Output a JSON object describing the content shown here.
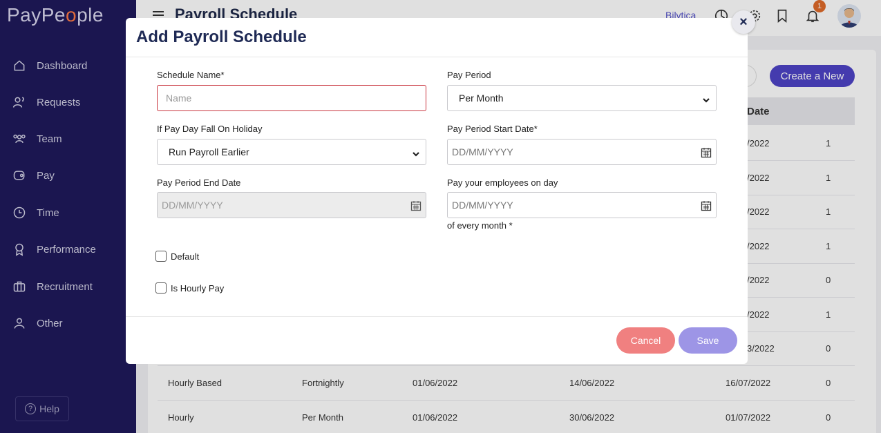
{
  "sidebar": {
    "logo": "PayPeople",
    "items": [
      {
        "label": "Dashboard",
        "icon": "home-icon"
      },
      {
        "label": "Requests",
        "icon": "request-icon"
      },
      {
        "label": "Team",
        "icon": "team-icon"
      },
      {
        "label": "Pay",
        "icon": "wallet-icon"
      },
      {
        "label": "Time",
        "icon": "clock-icon"
      },
      {
        "label": "Performance",
        "icon": "award-icon"
      },
      {
        "label": "Recruitment",
        "icon": "briefcase-icon"
      },
      {
        "label": "Other",
        "icon": "user-icon"
      }
    ],
    "help_label": "Help"
  },
  "header": {
    "title": "Payroll Schedule",
    "company": "Bilytica",
    "notification_count": "1"
  },
  "page": {
    "create_button": "Create a New",
    "date_header": "Date",
    "rows": [
      {
        "end": "/2022",
        "count": "1"
      },
      {
        "end": "/2022",
        "count": "1"
      },
      {
        "end": "/2022",
        "count": "1"
      },
      {
        "end": "/2022",
        "count": "1"
      },
      {
        "end": "/2022",
        "count": "0"
      },
      {
        "end": "/2022",
        "count": "1"
      },
      {
        "end": "3/2022",
        "count": "0"
      },
      {
        "name": "Hourly Based",
        "period": "Fortnightly",
        "start": "01/06/2022",
        "end_date": "14/06/2022",
        "pay_date": "16/07/2022",
        "count": "0"
      },
      {
        "name": "Hourly",
        "period": "Per Month",
        "start": "01/06/2022",
        "end_date": "30/06/2022",
        "pay_date": "01/07/2022",
        "count": "0"
      }
    ]
  },
  "modal": {
    "title": "Add Payroll Schedule",
    "schedule_name_label": "Schedule Name*",
    "schedule_name_placeholder": "Name",
    "pay_period_label": "Pay Period",
    "pay_period_value": "Per Month",
    "holiday_label": "If Pay Day Fall On Holiday",
    "holiday_value": "Run Payroll Earlier",
    "start_date_label": "Pay Period Start Date*",
    "start_date_placeholder": "DD/MM/YYYY",
    "end_date_label": "Pay Period End Date",
    "end_date_placeholder": "DD/MM/YYYY",
    "pay_day_label": "Pay your employees on day",
    "pay_day_placeholder": "DD/MM/YYYY",
    "pay_day_helper": "of every month *",
    "default_label": "Default",
    "hourly_label": "Is Hourly Pay",
    "cancel_label": "Cancel",
    "save_label": "Save"
  }
}
